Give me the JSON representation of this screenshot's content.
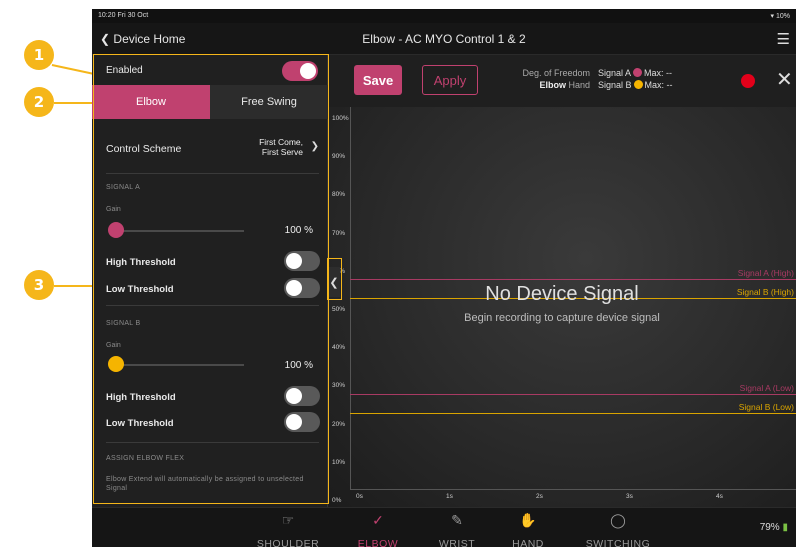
{
  "status_bar": {
    "time": "10:20  Fri 30 Oct",
    "battery": "▾ 10%"
  },
  "nav": {
    "back_label": "Device Home",
    "title": "Elbow - AC MYO Control 1 & 2"
  },
  "callouts": [
    "1",
    "2",
    "3"
  ],
  "left_panel": {
    "enabled_label": "Enabled",
    "enabled": true,
    "segments": [
      "Elbow",
      "Free Swing"
    ],
    "active_segment": "Elbow",
    "control_scheme_label": "Control Scheme",
    "control_scheme_value_1": "First Come,",
    "control_scheme_value_2": "First Serve",
    "signal_a": {
      "section": "SIGNAL A",
      "gain_label": "Gain",
      "gain_value": "100 %",
      "high_threshold_label": "High Threshold",
      "low_threshold_label": "Low Threshold",
      "color": "#c0416f"
    },
    "signal_b": {
      "section": "SIGNAL B",
      "gain_label": "Gain",
      "gain_value": "100 %",
      "high_threshold_label": "High Threshold",
      "low_threshold_label": "Low Threshold",
      "color": "#f5b400"
    },
    "assign_section": "ASSIGN ELBOW FLEX",
    "assign_note": "Elbow Extend will automatically be assigned to unselected Signal"
  },
  "toolbar": {
    "save_label": "Save",
    "apply_label": "Apply",
    "dof_label": "Deg. of Freedom",
    "dof_elbow": "Elbow",
    "dof_hand": "Hand",
    "signal_a_label": "Signal A",
    "signal_b_label": "Signal B",
    "max_a": "Max:  --",
    "max_b": "Max:  --"
  },
  "plot": {
    "y_ticks": [
      "100%",
      "90%",
      "80%",
      "70%",
      "60%",
      "50%",
      "40%",
      "30%",
      "20%",
      "10%",
      "0%"
    ],
    "x_ticks": [
      "0s",
      "1s",
      "2s",
      "3s",
      "4s"
    ],
    "empty_title": "No Device Signal",
    "empty_subtitle": "Begin recording to capture device signal",
    "threshold_labels": {
      "a_high": "Signal A (High)",
      "b_high": "Signal B (High)",
      "a_low": "Signal A (Low)",
      "b_low": "Signal B (Low)"
    },
    "thresholds_pct": {
      "a_high": 55,
      "b_high": 50,
      "a_low": 25,
      "b_low": 20
    }
  },
  "tabs": [
    {
      "label": "SHOULDER",
      "icon": "shoulder-icon"
    },
    {
      "label": "ELBOW",
      "icon": "elbow-icon",
      "active": true
    },
    {
      "label": "WRIST",
      "icon": "wrist-icon"
    },
    {
      "label": "HAND",
      "icon": "hand-icon"
    },
    {
      "label": "SWITCHING",
      "icon": "switching-icon"
    }
  ],
  "device_battery": "79%"
}
